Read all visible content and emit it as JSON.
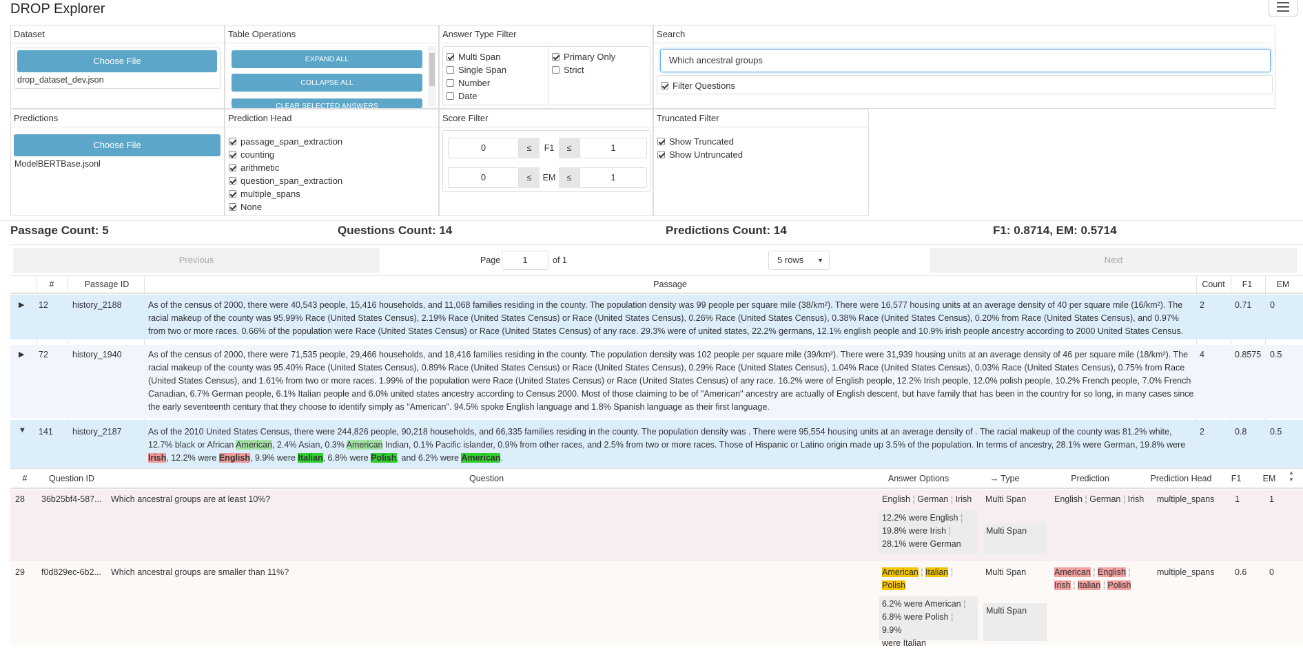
{
  "app": {
    "title": "DROP Explorer"
  },
  "dataset": {
    "header": "Dataset",
    "choose_label": "Choose File",
    "file": "drop_dataset_dev.json"
  },
  "table_ops": {
    "header": "Table Operations",
    "expand": "EXPAND ALL",
    "collapse": "COLLAPSE ALL",
    "clear": "CLEAR SELECTED ANSWERS"
  },
  "answer_type": {
    "header": "Answer Type Filter",
    "multi_span": "Multi Span",
    "single_span": "Single Span",
    "number": "Number",
    "date": "Date",
    "primary_only": "Primary Only",
    "strict": "Strict"
  },
  "search": {
    "header": "Search",
    "value": "Which ancestral groups",
    "filter_questions": "Filter Questions"
  },
  "predictions": {
    "header": "Predictions",
    "choose_label": "Choose File",
    "file": "ModelBERTBase.jsonl"
  },
  "pred_head": {
    "header": "Prediction Head",
    "items": [
      "passage_span_extraction",
      "counting",
      "arithmetic",
      "question_span_extraction",
      "multiple_spans",
      "None"
    ]
  },
  "score_filter": {
    "header": "Score Filter",
    "f1_min": "0",
    "f1_max": "1",
    "em_min": "0",
    "em_max": "1",
    "leq": "≤",
    "f1": "F1",
    "em": "EM"
  },
  "truncated": {
    "header": "Truncated Filter",
    "show_truncated": "Show Truncated",
    "show_untruncated": "Show Untruncated"
  },
  "stats": {
    "passages": "Passage Count: 5",
    "questions": "Questions Count: 14",
    "predictions": "Predictions Count: 14",
    "scores": "F1: 0.8714, EM: 0.5714"
  },
  "pager": {
    "prev": "Previous",
    "page_label": "Page",
    "page": "1",
    "of": "of 1",
    "rows": "5 rows",
    "next": "Next"
  },
  "passage_table": {
    "headers": {
      "num": "#",
      "id": "Passage ID",
      "passage": "Passage",
      "count": "Count",
      "f1": "F1",
      "em": "EM"
    },
    "rows": [
      {
        "num": "12",
        "id": "history_2188",
        "text": "As of the census of 2000, there were 40,543 people, 15,416 households, and 11,068 families residing in the county. The population density was 99 people per square mile (38/km²). There were 16,577 housing units at an average density of 40 per square mile (16/km²). The racial makeup of the county was 95.99% Race (United States Census), 2.19% Race (United States Census) or Race (United States Census), 0.26% Race (United States Census), 0.38% Race (United States Census), 0.20% from Race (United States Census), and 0.97% from two or more races. 0.66% of the population were Race (United States Census) or Race (United States Census) of any race. 29.3% were of united states, 22.2% germans, 12.1% english people and 10.9% irish people ancestry according to 2000 United States Census.",
        "count": "2",
        "f1": "0.71",
        "em": "0"
      },
      {
        "num": "72",
        "id": "history_1940",
        "text": "As of the census of 2000, there were 71,535 people, 29,466 households, and 18,416 families residing in the county.  The population density was 102 people per square mile (39/km²).  There were 31,939 housing units at an average density of 46 per square mile (18/km²).  The racial makeup of the county was 95.40% Race (United States Census), 0.89% Race (United States Census) or Race (United States Census), 0.29% Race (United States Census), 1.04% Race (United States Census), 0.03% Race (United States Census), 0.75% from Race (United States Census), and 1.61% from two or more races.  1.99% of the population were Race (United States Census) or Race (United States Census) of any race. 16.2% were of English people, 12.2% Irish people, 12.0% polish people, 10.2% French people, 7.0% French Canadian, 6.7% German people, 6.1% Italian people and 6.0% united states ancestry according to Census 2000.  Most of those claiming to be of \"American\" ancestry are actually of English descent, but have family that has been in the country for so long, in many cases since the early seventeenth century that they choose to identify simply as \"American\". 94.5% spoke English language and 1.8% Spanish language as their first language.",
        "count": "4",
        "f1": "0.8575",
        "em": "0.5"
      },
      {
        "num": "141",
        "id": "history_2187",
        "t1": "As of the 2010 United States Census, there were 244,826 people, 90,218 households, and 66,335 families residing in the county. The population density was . There were 95,554 housing units at an average density of . The racial makeup of the county was 81.2% white, 12.7% black or African ",
        "h1": "American",
        "t2": ", 2.4% Asian, 0.3% ",
        "h2": "American",
        "t3": " Indian, 0.1% Pacific islander, 0.9% from other races, and 2.5% from two or more races. Those of Hispanic or Latino origin made up 3.5% of the population. In terms of ancestry, 28.1% were German, 19.8% were ",
        "h3": "Irish",
        "t4": ", 12.2% were ",
        "h4": "English",
        "t5": ", 9.9% were ",
        "h5": "Italian",
        "t6": ", 6.8% were ",
        "h6": "Polish",
        "t7": ", and 6.2% were ",
        "h7": "American",
        "t8": ".",
        "count": "2",
        "f1": "0.8",
        "em": "0.5"
      }
    ]
  },
  "question_table": {
    "headers": {
      "num": "#",
      "qid": "Question ID",
      "question": "Question",
      "answers": "Answer Options",
      "type": "→ Type",
      "prediction": "Prediction",
      "head": "Prediction Head",
      "f1": "F1",
      "em": "EM"
    },
    "rows": [
      {
        "num": "28",
        "qid": "36b25bf4-587...",
        "question": "Which ancestral groups are at least 10%?",
        "ans1": "English",
        "ans2": "German",
        "ans3": "Irish",
        "alt1": "12.2% were English",
        "alt2": "19.8% were Irish",
        "alt3": "28.1% were German",
        "type1": "Multi Span",
        "type2": "Multi Span",
        "p1": "English",
        "p2": "German",
        "p3": "Irish",
        "head": "multiple_spans",
        "f1": "1",
        "em": "1"
      },
      {
        "num": "29",
        "qid": "f0d829ec-6b2...",
        "question": "Which ancestral groups are smaller than 11%?",
        "ans1": "American",
        "ans2": "Italian",
        "ans3": "Polish",
        "alt1": "6.2% were American",
        "alt2": "6.8% were Polish",
        "alt3": "9.9%",
        "alt4": "were Italian",
        "type1": "Multi Span",
        "type2": "Multi Span",
        "p1": "American",
        "p2": "English",
        "p3": "Irish",
        "p4": "Italian",
        "p5": "Polish",
        "head": "multiple_spans",
        "f1": "0.6",
        "em": "0"
      }
    ]
  }
}
